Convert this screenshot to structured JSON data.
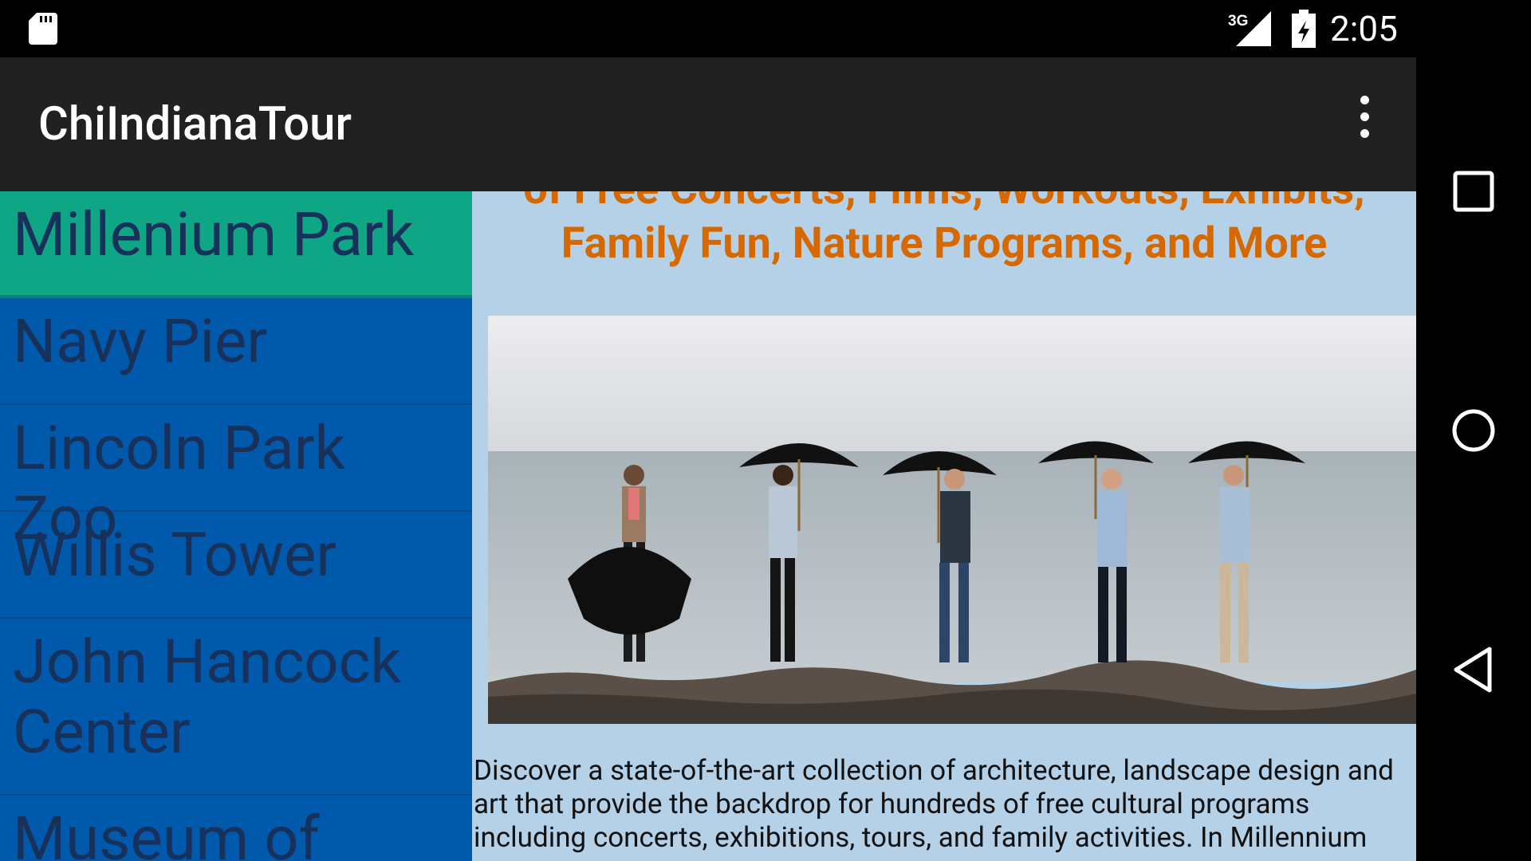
{
  "status_bar": {
    "network": "3G",
    "time": "2:05",
    "icons": [
      "sd-card-icon",
      "signal-icon",
      "battery-icon"
    ]
  },
  "action_bar": {
    "title": "ChiIndianaTour",
    "overflow_icon": "more-vert-icon"
  },
  "sidebar": {
    "items": [
      {
        "label": "Millenium Park",
        "active": true
      },
      {
        "label": "Navy Pier"
      },
      {
        "label": "Lincoln Park Zoo"
      },
      {
        "label": "Willis Tower"
      },
      {
        "label": "John Hancock Center"
      },
      {
        "label": "Museum of"
      }
    ]
  },
  "content": {
    "headline": "of Free Concerts, Films, Workouts, Exhibits, Family Fun, Nature Programs, and More",
    "photo": "photo of five men standing on a stone breakwater holding black umbrellas",
    "description": "Discover a state-of-the-art collection of architecture, landscape design and art that provide the backdrop for hundreds of free cultural programs including concerts, exhibitions, tours, and family activities. In Millennium"
  },
  "nav_bar": {
    "buttons": [
      "recents-icon",
      "home-icon",
      "back-icon"
    ]
  },
  "colors": {
    "active_item": "#0fa686",
    "list_bg": "#0059ab",
    "content_bg": "#b4d1e8",
    "headline": "#d66800",
    "action_bar": "#212121"
  }
}
